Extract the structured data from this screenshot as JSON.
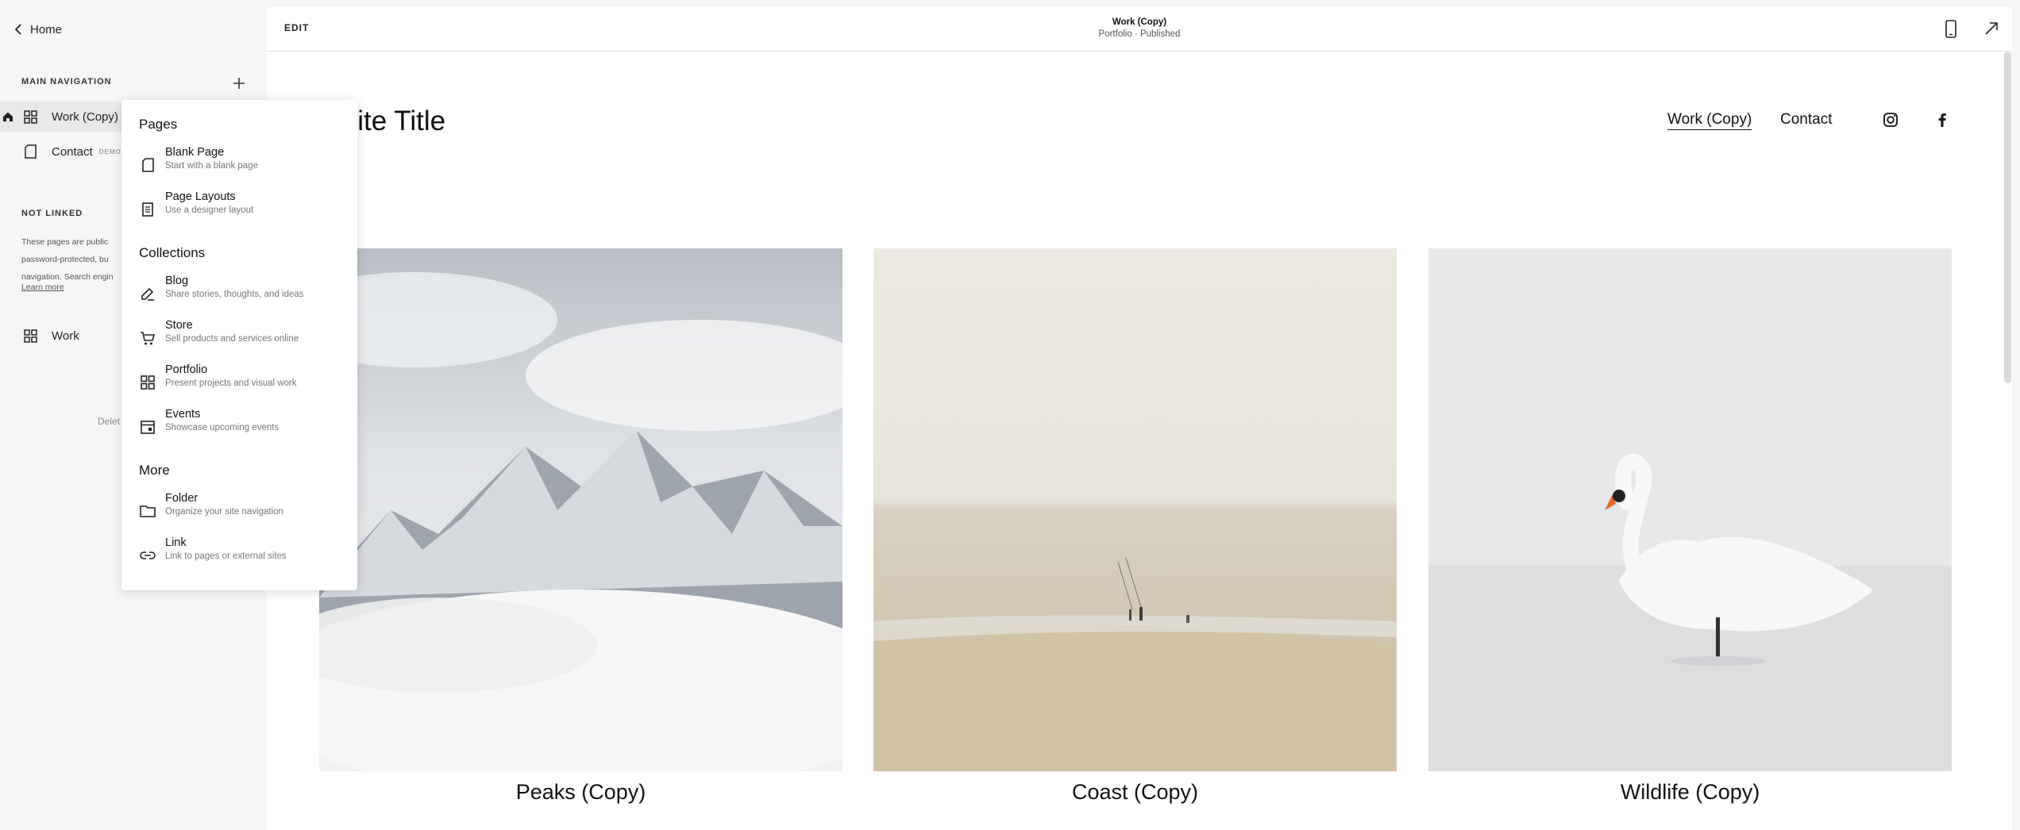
{
  "sidebar": {
    "home_label": "Home",
    "main_nav_label": "MAIN NAVIGATION",
    "pages": [
      {
        "label": "Work (Copy)",
        "badge": ""
      },
      {
        "label": "Contact",
        "badge": "DEMO"
      }
    ],
    "not_linked_label": "NOT LINKED",
    "not_linked_desc_lines": [
      "These pages are public",
      "password-protected, bu",
      "navigation. Search engin"
    ],
    "learn_more": "Learn more",
    "unlinked_pages": [
      {
        "label": "Work"
      }
    ],
    "delete_text": "Delet"
  },
  "toolbar": {
    "edit_label": "EDIT",
    "page_title": "Work (Copy)",
    "page_status": "Portfolio · Published"
  },
  "site": {
    "title": "ur Site Title",
    "nav": [
      "Work (Copy)",
      "Contact"
    ],
    "social_icons": [
      "instagram-icon",
      "facebook-icon"
    ]
  },
  "gallery": [
    {
      "caption": "Peaks (Copy)"
    },
    {
      "caption": "Coast (Copy)"
    },
    {
      "caption": "Wildlife (Copy)"
    }
  ],
  "menu": {
    "pages_heading": "Pages",
    "pages_items": [
      {
        "title": "Blank Page",
        "sub": "Start with a blank page",
        "icon": "blank-page-icon"
      },
      {
        "title": "Page Layouts",
        "sub": "Use a designer layout",
        "icon": "layout-icon"
      }
    ],
    "collections_heading": "Collections",
    "collections_items": [
      {
        "title": "Blog",
        "sub": "Share stories, thoughts, and ideas",
        "icon": "blog-icon"
      },
      {
        "title": "Store",
        "sub": "Sell products and services online",
        "icon": "cart-icon"
      },
      {
        "title": "Portfolio",
        "sub": "Present projects and visual work",
        "icon": "grid-icon"
      },
      {
        "title": "Events",
        "sub": "Showcase upcoming events",
        "icon": "calendar-icon"
      }
    ],
    "more_heading": "More",
    "more_items": [
      {
        "title": "Folder",
        "sub": "Organize your site navigation",
        "icon": "folder-icon"
      },
      {
        "title": "Link",
        "sub": "Link to pages or external sites",
        "icon": "link-icon"
      }
    ]
  },
  "colors": {
    "sidebar_bg": "#f6f6f6",
    "active_row": "#e8e8e8",
    "menu_bg": "#ffffff"
  }
}
